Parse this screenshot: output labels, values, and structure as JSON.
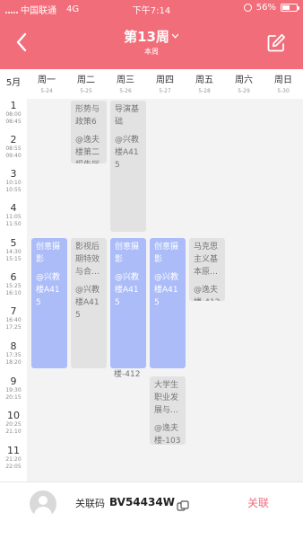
{
  "status_bar": {
    "carrier": "中国联通",
    "network": "4G",
    "time": "下午7:14",
    "battery": "56%",
    "battery_level": 0.56
  },
  "header": {
    "title": "第13周",
    "subtitle": "本周",
    "back_icon": "chevron-left-icon",
    "edit_icon": "edit-icon",
    "color": "#f26d7a"
  },
  "week": {
    "month": "5月",
    "days": [
      {
        "name": "周一",
        "date": "5-24"
      },
      {
        "name": "周二",
        "date": "5-25"
      },
      {
        "name": "周三",
        "date": "5-26"
      },
      {
        "name": "周四",
        "date": "5-27"
      },
      {
        "name": "周五",
        "date": "5-28"
      },
      {
        "name": "周六",
        "date": "5-29"
      },
      {
        "name": "周日",
        "date": "5-30"
      }
    ]
  },
  "periods": [
    {
      "n": "1",
      "start": "08:00",
      "end": "08:45"
    },
    {
      "n": "2",
      "start": "08:55",
      "end": "09:40"
    },
    {
      "n": "3",
      "start": "10:10",
      "end": "10:55"
    },
    {
      "n": "4",
      "start": "11:05",
      "end": "11:50"
    },
    {
      "n": "5",
      "start": "14:30",
      "end": "15:15"
    },
    {
      "n": "6",
      "start": "15:25",
      "end": "16:10"
    },
    {
      "n": "7",
      "start": "16:40",
      "end": "17:25"
    },
    {
      "n": "8",
      "start": "17:35",
      "end": "18:20"
    },
    {
      "n": "9",
      "start": "19:30",
      "end": "20:15"
    },
    {
      "n": "10",
      "start": "20:25",
      "end": "21:10"
    },
    {
      "n": "11",
      "start": "21:20",
      "end": "22:05"
    }
  ],
  "courses": [
    {
      "name": "形势与政策6",
      "loc": "@逸夫楼第二报告厅",
      "style": "gray"
    },
    {
      "name": "导演基础",
      "loc": "@兴教楼A415",
      "style": "gray"
    },
    {
      "name": "创意摄影",
      "loc": "@兴教楼A415",
      "style": "blue"
    },
    {
      "name": "影视后期特效与合…",
      "loc": "@兴教楼A415",
      "style": "gray"
    },
    {
      "name": "创意摄影",
      "loc": "@兴教楼A415",
      "style": "blue"
    },
    {
      "name": "创意摄影",
      "loc": "@兴教楼A415",
      "style": "blue"
    },
    {
      "name": "马克思主义基本原…",
      "loc": "@逸夫楼-412",
      "style": "gray"
    },
    {
      "name": "大学生职业发展与…",
      "loc": "@逸夫楼-103",
      "style": "gray"
    }
  ],
  "overflow_texts": [
    "楼-412"
  ],
  "colors": {
    "blue_course": "#abbcf8",
    "gray_course": "#e2e2e2",
    "accent": "#f26d7a"
  },
  "bottom": {
    "avatar_icon": "user-avatar-icon",
    "code_label": "关联码",
    "code_value": "BV54434W",
    "copy_icon": "copy-icon",
    "action_label": "关联"
  }
}
